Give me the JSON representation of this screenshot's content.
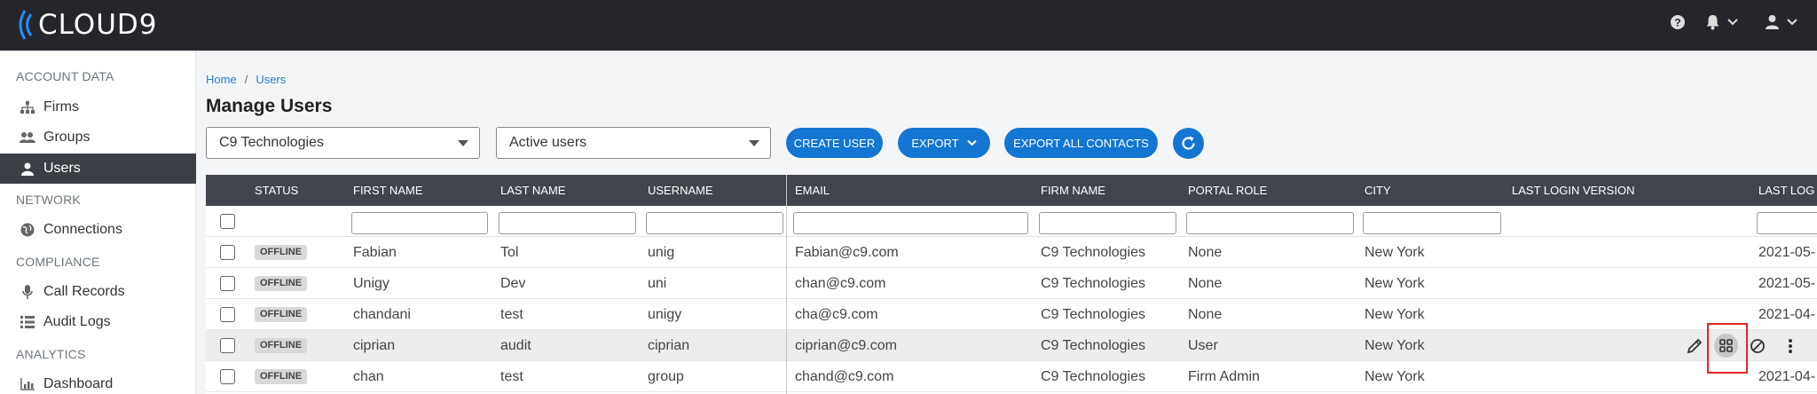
{
  "app": {
    "logo_text": "CLOUD9"
  },
  "topbar": {
    "help_icon": "help-icon",
    "bell_icon": "bell-icon",
    "user_icon": "user-icon"
  },
  "sidebar": {
    "sections": [
      {
        "label": "ACCOUNT DATA"
      },
      {
        "label": "NETWORK"
      },
      {
        "label": "COMPLIANCE"
      },
      {
        "label": "ANALYTICS"
      }
    ],
    "items": [
      {
        "label": "Firms",
        "icon": "sitemap-icon"
      },
      {
        "label": "Groups",
        "icon": "users-group-icon"
      },
      {
        "label": "Users",
        "icon": "user-icon",
        "active": true
      },
      {
        "label": "Connections",
        "icon": "globe-icon"
      },
      {
        "label": "Call Records",
        "icon": "microphone-icon"
      },
      {
        "label": "Audit Logs",
        "icon": "list-icon"
      },
      {
        "label": "Dashboard",
        "icon": "bar-chart-icon"
      }
    ]
  },
  "breadcrumb": {
    "home": "Home",
    "separator": "/",
    "current": "Users"
  },
  "page": {
    "title": "Manage Users"
  },
  "filters": {
    "firm_select": "C9 Technologies",
    "status_select": "Active users"
  },
  "buttons": {
    "create_user": "CREATE USER",
    "export": "EXPORT",
    "export_all": "EXPORT ALL CONTACTS"
  },
  "colors": {
    "accent": "#1476d2",
    "topbar": "#24262b",
    "header": "#41454d",
    "highlight": "#e2252b"
  },
  "table": {
    "columns": [
      "STATUS",
      "FIRST NAME",
      "LAST NAME",
      "USERNAME",
      "EMAIL",
      "FIRM NAME",
      "PORTAL ROLE",
      "CITY",
      "LAST LOGIN VERSION",
      "LAST LOG"
    ],
    "rows": [
      {
        "status": "OFFLINE",
        "first": "Fabian",
        "last": "Tol",
        "username": "unig",
        "email": "Fabian@c9.com",
        "firm": "C9 Technologies",
        "role": "None",
        "city": "New York",
        "last_login": "2021-05-"
      },
      {
        "status": "OFFLINE",
        "first": "Unigy",
        "last": "Dev",
        "username": "uni",
        "email": "chan@c9.com",
        "firm": "C9 Technologies",
        "role": "None",
        "city": "New York",
        "last_login": "2021-05-"
      },
      {
        "status": "OFFLINE",
        "first": "chandani",
        "last": "test",
        "username": "unigy",
        "email": "cha@c9.com",
        "firm": "C9 Technologies",
        "role": "None",
        "city": "New York",
        "last_login": "2021-04-"
      },
      {
        "status": "OFFLINE",
        "first": "ciprian",
        "last": "audit",
        "username": "ciprian",
        "email": "ciprian@c9.com",
        "firm": "C9 Technologies",
        "role": "User",
        "city": "New York",
        "last_login": ""
      },
      {
        "status": "OFFLINE",
        "first": "chan",
        "last": "test",
        "username": "group",
        "email": "chand@c9.com",
        "firm": "C9 Technologies",
        "role": "Firm Admin",
        "city": "New York",
        "last_login": "2021-04-"
      }
    ]
  },
  "row_actions": [
    "edit-icon",
    "grid-icon",
    "block-icon",
    "more-vertical-icon"
  ]
}
